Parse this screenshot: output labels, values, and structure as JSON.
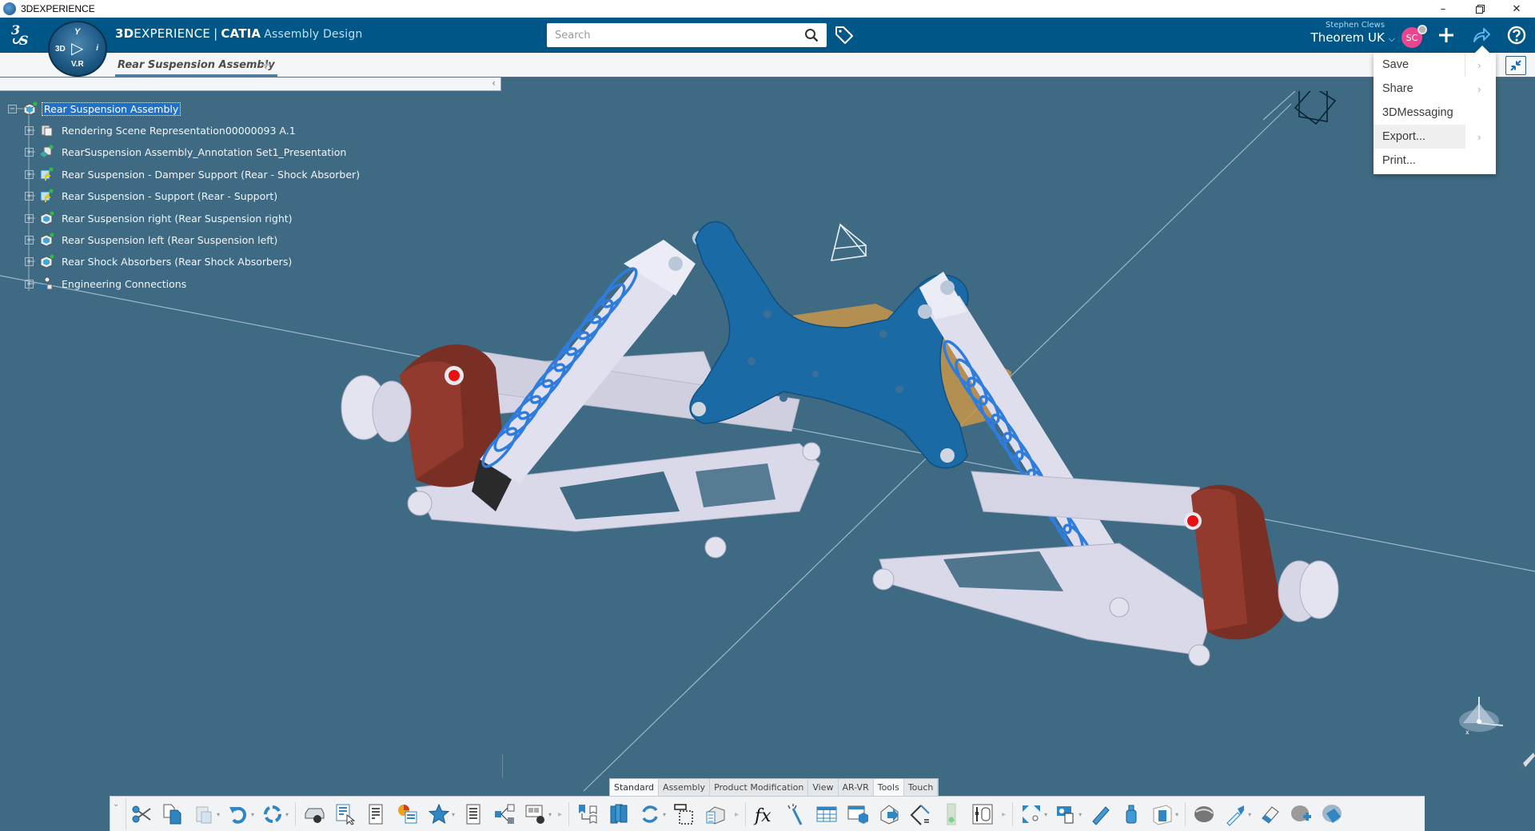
{
  "window": {
    "title": "3DEXPERIENCE",
    "controls": [
      "minimize",
      "restore",
      "close"
    ]
  },
  "header": {
    "brand_bold": "3D",
    "brand_rest": "EXPERIENCE",
    "brand_separator": "|",
    "brand_product": "CATIA",
    "app_name": "Assembly Design",
    "compass": {
      "top": "Y",
      "left": "3D",
      "center": "▷",
      "right": "i",
      "bottom": "V.R"
    },
    "search": {
      "placeholder": "Search",
      "value": ""
    },
    "user": {
      "name": "Stephen Clews",
      "tenant": "Theorem UK",
      "initials": "SC"
    },
    "icons": [
      "tag-icon",
      "add-icon",
      "share-icon",
      "help-icon"
    ]
  },
  "tabs": {
    "items": [
      {
        "label": "Rear Suspension Assembly",
        "active": true
      }
    ],
    "add_label": "+"
  },
  "tree_panel": {
    "collapse_label": "‹",
    "root": {
      "label": "Rear Suspension Assembly",
      "selected": true,
      "expanded": true
    },
    "children": [
      {
        "label": "Rendering Scene Representation00000093 A.1",
        "icon": "rendering-scene-icon"
      },
      {
        "label": "RearSuspension Assembly_Annotation Set1_Presentation",
        "icon": "annotation-set-icon"
      },
      {
        "label": "Rear Suspension - Damper Support (Rear - Shock Absorber)",
        "icon": "product-flexible-icon"
      },
      {
        "label": "Rear Suspension - Support (Rear - Support)",
        "icon": "product-flexible-icon"
      },
      {
        "label": "Rear Suspension right (Rear Suspension right)",
        "icon": "product-icon"
      },
      {
        "label": "Rear Suspension left (Rear Suspension left)",
        "icon": "product-icon"
      },
      {
        "label": "Rear Shock Absorbers (Rear Shock Absorbers)",
        "icon": "product-icon"
      },
      {
        "label": "Engineering Connections",
        "icon": "engineering-connections-icon"
      }
    ]
  },
  "share_menu": {
    "items": [
      {
        "label": "Save",
        "submenu": true,
        "highlighted": false
      },
      {
        "label": "Share",
        "submenu": true,
        "highlighted": false
      },
      {
        "label": "3DMessaging",
        "submenu": false,
        "highlighted": false
      },
      {
        "label": "Export...",
        "submenu": true,
        "highlighted": true
      },
      {
        "label": "Print...",
        "submenu": false,
        "highlighted": false
      }
    ],
    "submenu_arrow": "›"
  },
  "action_bar": {
    "tabs": [
      {
        "label": "Standard",
        "active": true
      },
      {
        "label": "Assembly",
        "active": false
      },
      {
        "label": "Product Modification",
        "active": false
      },
      {
        "label": "View",
        "active": false
      },
      {
        "label": "AR-VR",
        "active": false
      },
      {
        "label": "Tools",
        "active": false
      },
      {
        "label": "Touch",
        "active": false
      }
    ],
    "expand_label": "⌄",
    "commands": [
      "cut-icon",
      "copy-icon",
      "paste-icon",
      "undo-icon",
      "update-icon",
      "product-properties-icon",
      "select-icon",
      "table-icon",
      "color-table-icon",
      "favorites-icon",
      "document-list-icon",
      "tree-structure-icon",
      "settings-icon",
      "bookmark-tree-icon",
      "books-icon",
      "refresh-icon",
      "selection-box-icon",
      "assembly-table-icon",
      "formula-icon",
      "magic-wand-icon",
      "grid-table-icon",
      "table-3d-icon",
      "import-geometry-icon",
      "angle-measure-icon",
      "traffic-light-icon",
      "data-panel-icon",
      "explode-icon",
      "clash-icon",
      "measure-ruler-icon",
      "bottle-icon",
      "section-view-icon",
      "shading-icon",
      "eyedropper-icon",
      "eraser-icon",
      "add-material-icon",
      "apply-material-icon"
    ]
  },
  "colors": {
    "header_bg": "#005686",
    "viewport_bg": "#3f6a83",
    "selection": "#1f71c7",
    "avatar": "#e8468f",
    "support_plate": "#1a6aa6",
    "spring": "#2e7ad8",
    "hub": "#7a2f25",
    "arm": "#d8d8e8"
  }
}
